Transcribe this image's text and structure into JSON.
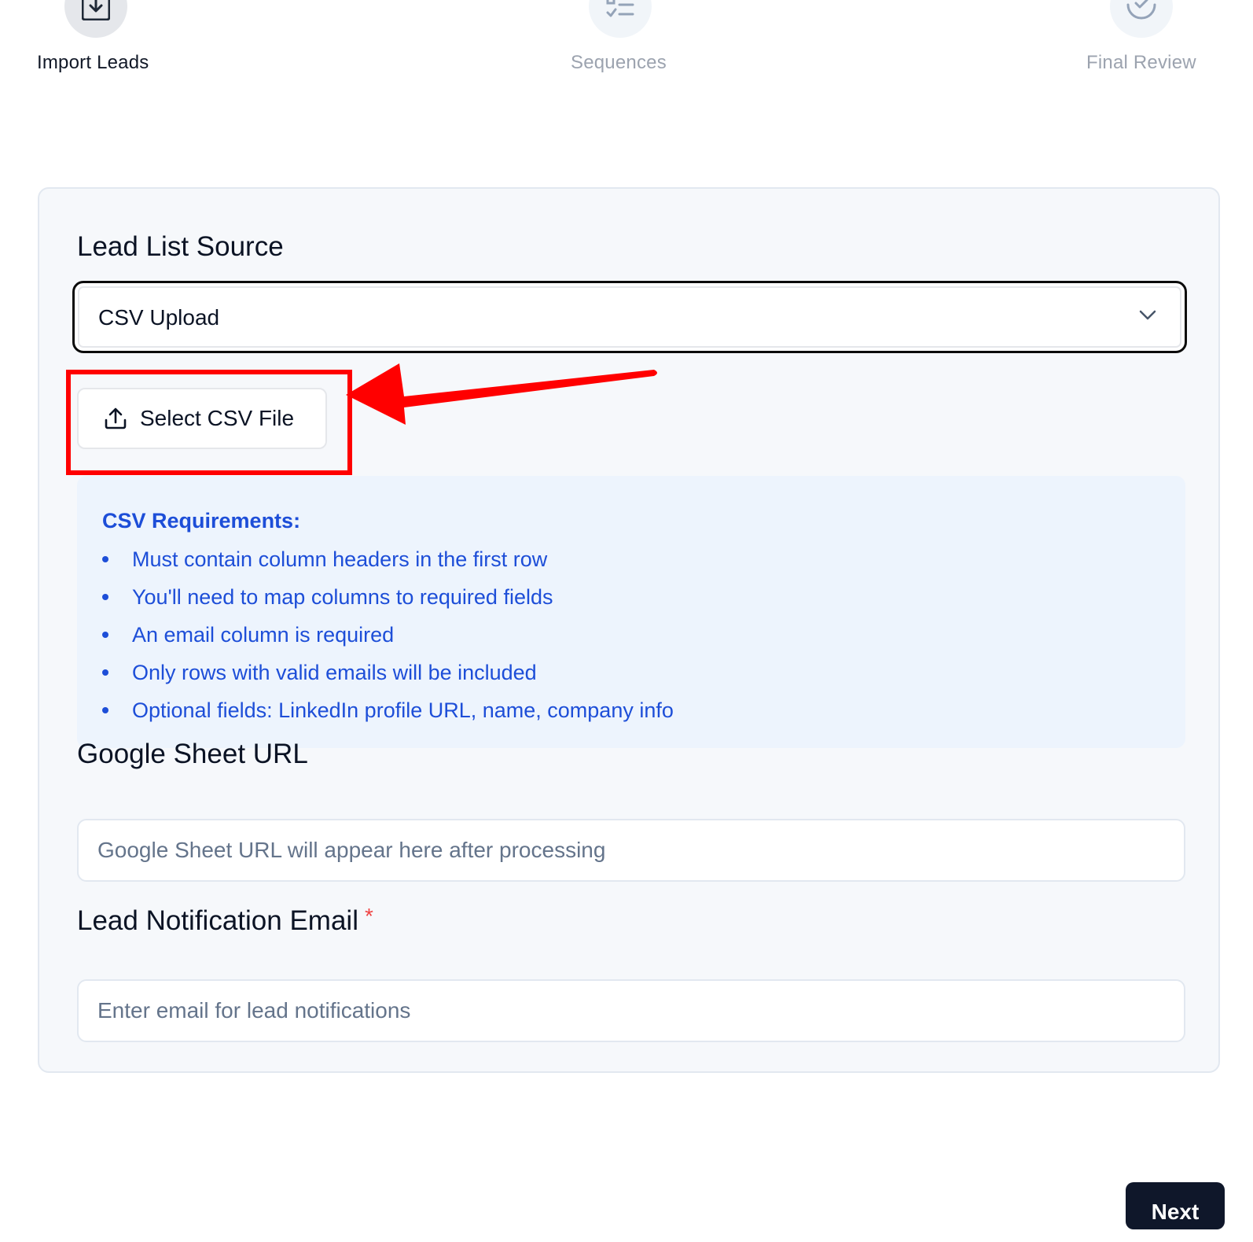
{
  "stepper": {
    "steps": [
      {
        "label": "Import Leads",
        "icon": "import-icon",
        "state": "active"
      },
      {
        "label": "Sequences",
        "icon": "list-check-icon",
        "state": "inactive"
      },
      {
        "label": "Final Review",
        "icon": "check-circle-icon",
        "state": "inactive"
      }
    ]
  },
  "form": {
    "lead_source": {
      "label": "Lead List Source",
      "selected": "CSV Upload"
    },
    "upload_button": {
      "label": "Select CSV File",
      "icon": "upload-icon"
    },
    "requirements": {
      "title": "CSV Requirements:",
      "items": [
        "Must contain column headers in the first row",
        "You'll need to map columns to required fields",
        "An email column is required",
        "Only rows with valid emails will be included",
        "Optional fields: LinkedIn profile URL, name, company info"
      ]
    },
    "google_sheet": {
      "label": "Google Sheet URL",
      "value": "",
      "placeholder": "Google Sheet URL will appear here after processing"
    },
    "notification_email": {
      "label": "Lead Notification Email",
      "required_marker": "*",
      "value": "",
      "placeholder": "Enter email for lead notifications"
    }
  },
  "footer": {
    "next_label": "Next"
  },
  "colors": {
    "highlight": "#ff0000",
    "accent_text": "#1d4ed8",
    "required": "#ef4444",
    "primary_button": "#0f172a"
  }
}
